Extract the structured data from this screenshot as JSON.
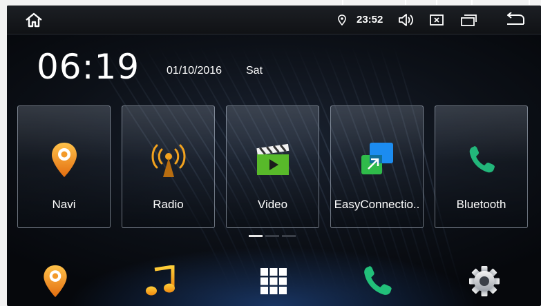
{
  "status_bar": {
    "home_icon": "home-icon",
    "location_icon": "location-pin-icon",
    "time": "23:52",
    "volume_icon": "volume-icon",
    "close_icon": "close-app-icon",
    "recents_icon": "recent-apps-icon",
    "back_icon": "back-icon"
  },
  "clock": {
    "time": "06:19",
    "date": "01/10/2016",
    "weekday": "Sat"
  },
  "apps": [
    {
      "label": "Navi",
      "icon": "navigation-pin-icon"
    },
    {
      "label": "Radio",
      "icon": "radio-antenna-icon"
    },
    {
      "label": "Video",
      "icon": "video-clapper-icon"
    },
    {
      "label": "EasyConnectio..",
      "icon": "easy-connection-icon"
    },
    {
      "label": "Bluetooth",
      "icon": "phone-icon"
    }
  ],
  "pager": {
    "pages": 3,
    "current": 1
  },
  "dock": [
    {
      "name": "navigation",
      "icon": "navigation-pin-icon"
    },
    {
      "name": "music",
      "icon": "music-note-icon"
    },
    {
      "name": "all-apps",
      "icon": "app-grid-icon"
    },
    {
      "name": "phone",
      "icon": "phone-icon"
    },
    {
      "name": "settings",
      "icon": "gear-icon"
    }
  ],
  "colors": {
    "accent_orange": "#f5a623",
    "accent_green": "#2fc65a",
    "status_white": "#ffffff",
    "background_dark": "#0c1017"
  }
}
